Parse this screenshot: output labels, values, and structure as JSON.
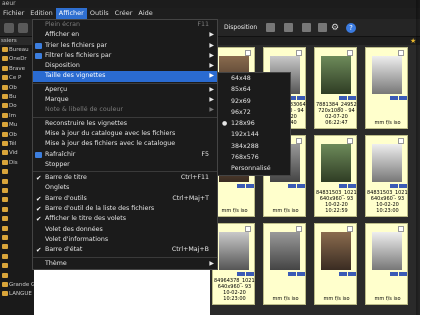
{
  "window": {
    "title": "aeur"
  },
  "menubar": {
    "items": [
      {
        "label": "Fichier",
        "active": false
      },
      {
        "label": "Edition",
        "active": false
      },
      {
        "label": "Afficher",
        "active": true
      },
      {
        "label": "Outils",
        "active": false
      },
      {
        "label": "Créer",
        "active": false
      },
      {
        "label": "Aide",
        "active": false
      }
    ]
  },
  "toolbar": {
    "layout_label": "Disposition"
  },
  "folders": {
    "header": "ssiers",
    "items": [
      {
        "label": "Bureau"
      },
      {
        "label": "OneDr"
      },
      {
        "label": "Brave"
      },
      {
        "label": "Ce P"
      },
      {
        "label": "Ob"
      },
      {
        "label": "Bu"
      },
      {
        "label": "Do"
      },
      {
        "label": "Im"
      },
      {
        "label": "Mu"
      },
      {
        "label": "Ob"
      },
      {
        "label": "Tél"
      },
      {
        "label": "Vid"
      },
      {
        "label": "Dis"
      },
      {
        "label": ""
      },
      {
        "label": ""
      },
      {
        "label": ""
      },
      {
        "label": ""
      },
      {
        "label": ""
      },
      {
        "label": ""
      },
      {
        "label": ""
      },
      {
        "label": ""
      },
      {
        "label": ""
      },
      {
        "label": ""
      },
      {
        "label": ""
      },
      {
        "label": ""
      },
      {
        "label": "Grande Guerre Octobre 2"
      },
      {
        "label": "LANGUE"
      }
    ]
  },
  "view_menu": {
    "items": [
      {
        "label": "Plein écran",
        "shortcut": "F11",
        "disabled": true,
        "check": false,
        "icon": false,
        "arrow": false
      },
      {
        "label": "Afficher en",
        "shortcut": "",
        "disabled": false,
        "check": false,
        "icon": false,
        "arrow": true
      },
      {
        "label": "Trier les fichiers par",
        "shortcut": "",
        "disabled": false,
        "check": false,
        "icon": true,
        "arrow": true
      },
      {
        "label": "Filtrer les fichiers par",
        "shortcut": "",
        "disabled": false,
        "check": false,
        "icon": true,
        "arrow": true
      },
      {
        "label": "Disposition",
        "shortcut": "",
        "disabled": false,
        "check": false,
        "icon": false,
        "arrow": true
      },
      {
        "label": "Taille des vignettes",
        "shortcut": "",
        "disabled": false,
        "check": false,
        "icon": false,
        "arrow": true,
        "highlight": true
      },
      {
        "sep": true
      },
      {
        "label": "Aperçu",
        "shortcut": "",
        "disabled": false,
        "check": false,
        "icon": false,
        "arrow": true
      },
      {
        "label": "Marque",
        "shortcut": "",
        "disabled": false,
        "check": false,
        "icon": false,
        "arrow": true
      },
      {
        "label": "Note & libellé de couleur",
        "shortcut": "",
        "disabled": true,
        "check": false,
        "icon": false,
        "arrow": true
      },
      {
        "sep": true
      },
      {
        "label": "Reconstruire les vignettes",
        "shortcut": "",
        "disabled": false,
        "check": false,
        "icon": false,
        "arrow": false
      },
      {
        "label": "Mise à jour du catalogue avec les fichiers",
        "shortcut": "",
        "disabled": false,
        "check": false,
        "icon": false,
        "arrow": false
      },
      {
        "label": "Mise à jour des fichiers avec le catalogue",
        "shortcut": "",
        "disabled": false,
        "check": false,
        "icon": false,
        "arrow": false
      },
      {
        "label": "Rafraîchir",
        "shortcut": "F5",
        "disabled": false,
        "check": false,
        "icon": true,
        "arrow": false
      },
      {
        "label": "Stopper",
        "shortcut": "",
        "disabled": false,
        "check": false,
        "icon": false,
        "arrow": false
      },
      {
        "sep": true
      },
      {
        "label": "Barre de titre",
        "shortcut": "Ctrl+F11",
        "disabled": false,
        "check": true,
        "icon": false,
        "arrow": false
      },
      {
        "label": "Onglets",
        "shortcut": "",
        "disabled": false,
        "check": false,
        "icon": false,
        "arrow": false
      },
      {
        "label": "Barre d'outils",
        "shortcut": "Ctrl+Maj+T",
        "disabled": false,
        "check": true,
        "icon": false,
        "arrow": false
      },
      {
        "label": "Barre d'outil de la liste des fichiers",
        "shortcut": "",
        "disabled": false,
        "check": true,
        "icon": false,
        "arrow": false
      },
      {
        "label": "Afficher le titre des volets",
        "shortcut": "",
        "disabled": false,
        "check": true,
        "icon": false,
        "arrow": false
      },
      {
        "label": "Volet des données",
        "shortcut": "",
        "disabled": false,
        "check": false,
        "icon": false,
        "arrow": false
      },
      {
        "label": "Volet d'informations",
        "shortcut": "",
        "disabled": false,
        "check": false,
        "icon": false,
        "arrow": false
      },
      {
        "label": "Barre d'état",
        "shortcut": "Ctrl+Maj+B",
        "disabled": false,
        "check": true,
        "icon": false,
        "arrow": false
      },
      {
        "sep": true
      },
      {
        "label": "Thème",
        "shortcut": "",
        "disabled": false,
        "check": false,
        "icon": false,
        "arrow": true
      }
    ]
  },
  "thumbnail_submenu": {
    "items": [
      {
        "label": "64x48",
        "selected": false
      },
      {
        "label": "85x64",
        "selected": false
      },
      {
        "label": "92x69",
        "selected": false
      },
      {
        "label": "96x72",
        "selected": false
      },
      {
        "label": "128x96",
        "selected": true
      },
      {
        "label": "192x144",
        "selected": false
      },
      {
        "label": "384x288",
        "selected": false
      },
      {
        "label": "768x576",
        "selected": false
      },
      {
        "label": "Personnalisé",
        "selected": false
      }
    ]
  },
  "thumbnails": [
    {
      "name": "",
      "dims": "",
      "date": "",
      "meta": "",
      "photo": "ph1"
    },
    {
      "name": "7463_24483064575...",
      "dims": "720x1080 - 94",
      "date": "02-07-20 06:22:40",
      "meta": "",
      "photo": "ph2"
    },
    {
      "name": "7881384_2495253984075...",
      "dims": "720x1080 - 94",
      "date": "02-07-20 06:22:47",
      "meta": "",
      "photo": "ph3"
    },
    {
      "name": "",
      "dims": "",
      "date": "",
      "meta": "mm f/s iso",
      "photo": "ph4"
    },
    {
      "name": "",
      "dims": "",
      "date": "",
      "meta": "mm f/s iso",
      "photo": "ph1"
    },
    {
      "name": "",
      "dims": "",
      "date": "",
      "meta": "mm f/s iso",
      "photo": "ph5"
    },
    {
      "name": "84831503_10219688865...",
      "dims": "640x960 - 93",
      "date": "10-02-20 10:22:59",
      "meta": "",
      "photo": "ph3"
    },
    {
      "name": "84831503_10219688861187...",
      "dims": "640x960 - 93",
      "date": "10-02-20 10:23:00",
      "meta": "",
      "photo": "ph4"
    },
    {
      "name": "84964378_10219688864187...",
      "dims": "640x960 - 93",
      "date": "10-02-20 10:23:00",
      "meta": "",
      "photo": "ph2"
    },
    {
      "name": "",
      "dims": "",
      "date": "",
      "meta": "mm f/s iso",
      "photo": "ph5"
    },
    {
      "name": "",
      "dims": "",
      "date": "",
      "meta": "mm f/s iso",
      "photo": "ph1"
    },
    {
      "name": "",
      "dims": "",
      "date": "",
      "meta": "mm f/s iso",
      "photo": "ph4"
    }
  ]
}
